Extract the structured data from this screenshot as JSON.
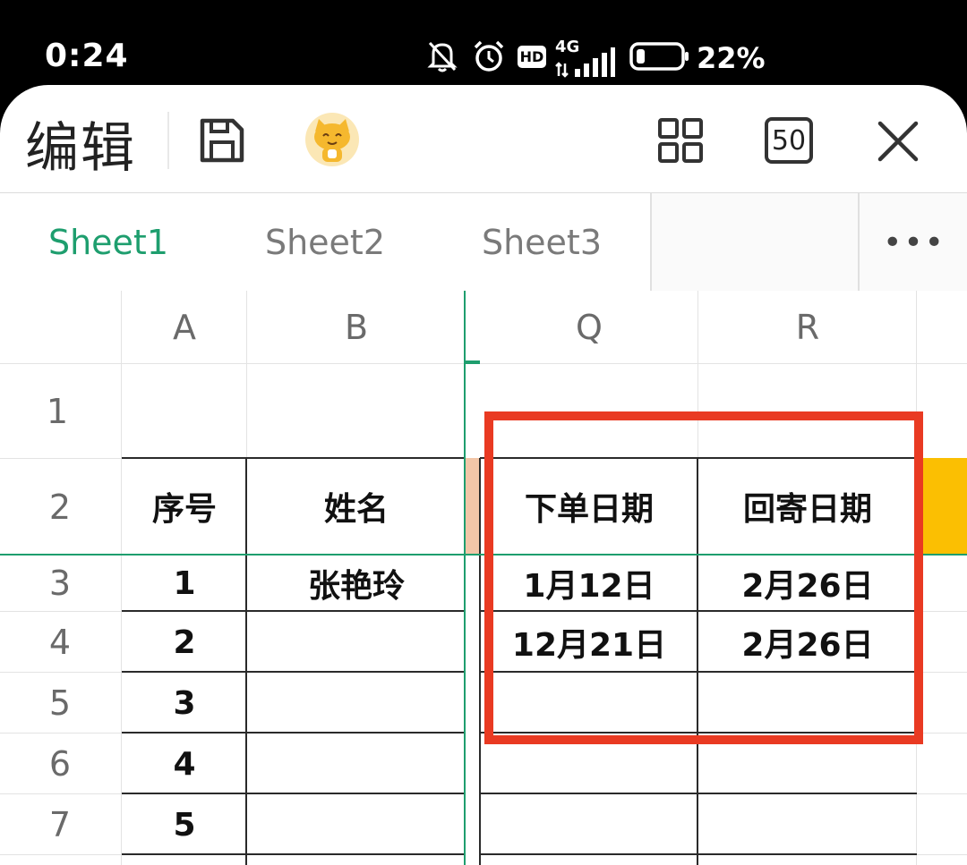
{
  "status_bar": {
    "time": "0:24",
    "network": "4G",
    "hd": "HD",
    "battery": "22%"
  },
  "toolbar": {
    "title": "编辑",
    "zoom_label": "50"
  },
  "tabs": [
    "Sheet1",
    "Sheet2",
    "Sheet3"
  ],
  "more_label": "•••",
  "columns": [
    "A",
    "B",
    "Q",
    "R"
  ],
  "rows": [
    "1",
    "2",
    "3",
    "4",
    "5",
    "6",
    "7"
  ],
  "table": {
    "headers": [
      "序号",
      "姓名",
      "下单日期",
      "回寄日期"
    ],
    "rows": [
      [
        "1",
        "张艳玲",
        "1月12日",
        "2月26日"
      ],
      [
        "2",
        "",
        "12月21日",
        "2月26日"
      ],
      [
        "3",
        "",
        "",
        ""
      ],
      [
        "4",
        "",
        "",
        ""
      ],
      [
        "5",
        "",
        "",
        ""
      ]
    ]
  },
  "colors": {
    "accent": "#1e9e6e",
    "highlight_box": "#e93a22",
    "cell_orange": "#fbbf02",
    "cell_peach": "#f2c6a8"
  }
}
